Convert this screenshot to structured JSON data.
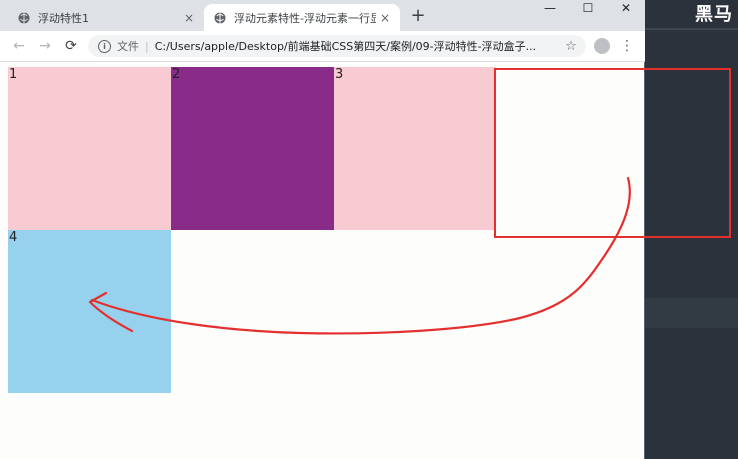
{
  "background_app": {
    "title": "黑马"
  },
  "browser": {
    "tabs": [
      {
        "title": "浮动特性1",
        "close": "×",
        "active": false
      },
      {
        "title": "浮动元素特性-浮动元素一行显示",
        "close": "×",
        "active": true
      }
    ],
    "new_tab": "+",
    "window_controls": {
      "minimize": "—",
      "maximize": "☐",
      "close": "✕"
    },
    "nav": {
      "back": "←",
      "forward": "→",
      "reload": "⟳"
    },
    "address": {
      "scheme_label": "文件",
      "separator": "|",
      "url": "C:/Users/apple/Desktop/前端基础CSS第四天/案例/09-浮动特性-浮动盒子...",
      "star": "☆"
    },
    "menu": "⋮"
  },
  "page": {
    "boxes": [
      {
        "label": "1",
        "color": "#f8cad1"
      },
      {
        "label": "2",
        "color": "#882b89"
      },
      {
        "label": "3",
        "color": "#f8cad1"
      },
      {
        "label": "4",
        "color": "#96d2ed"
      }
    ]
  },
  "annotation": {
    "color": "#e3302f",
    "meaning": "red rectangle marks the empty slot in row 1; red arrow points from it to box 4"
  }
}
